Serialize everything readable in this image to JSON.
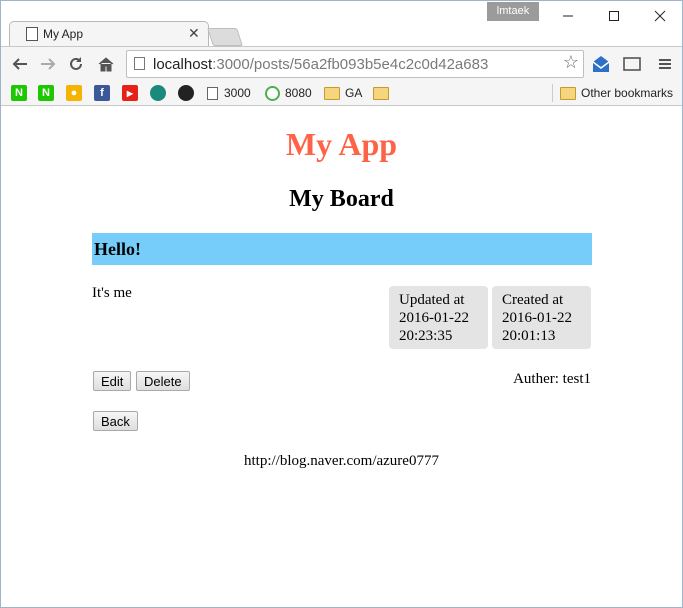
{
  "browser": {
    "user_name": "lmtaek",
    "tab_title": "My App",
    "url_host": "localhost",
    "url_path": ":3000/posts/56a2fb093b5e4c2c0d42a683"
  },
  "bookmarks": {
    "items": [
      {
        "label": "N",
        "icon": "naver-icon",
        "color": "#1ec800"
      },
      {
        "label": "N",
        "icon": "naver-icon",
        "color": "#1ec800"
      },
      {
        "label": "",
        "icon": "bulb-icon",
        "color": "#f4b400"
      },
      {
        "label": "f",
        "icon": "facebook-icon",
        "color": "#3b5998"
      },
      {
        "label": "▶",
        "icon": "youtube-icon",
        "color": "#e62117"
      },
      {
        "label": "",
        "icon": "app-icon",
        "color": "#1b8a7a"
      },
      {
        "label": "",
        "icon": "github-icon",
        "color": "#222222"
      }
    ],
    "page_3000": "3000",
    "page_8080": "8080",
    "folder_ga": "GA",
    "other_bookmarks": "Other bookmarks"
  },
  "app": {
    "title": "My App",
    "board_title": "My Board",
    "post": {
      "title": "Hello!",
      "body": "It's me",
      "updated_label": "Updated at",
      "updated_date": "2016-01-22",
      "updated_time": "20:23:35",
      "created_label": "Created at",
      "created_date": "2016-01-22",
      "created_time": "20:01:13",
      "author": "Auther: test1"
    },
    "buttons": {
      "edit": "Edit",
      "delete": "Delete",
      "back": "Back"
    },
    "footer": "http://blog.naver.com/azure0777"
  },
  "colors": {
    "app_title": "#ff6347",
    "title_bar": "#76cdfa",
    "stamp_bg": "#e4e4e4"
  }
}
